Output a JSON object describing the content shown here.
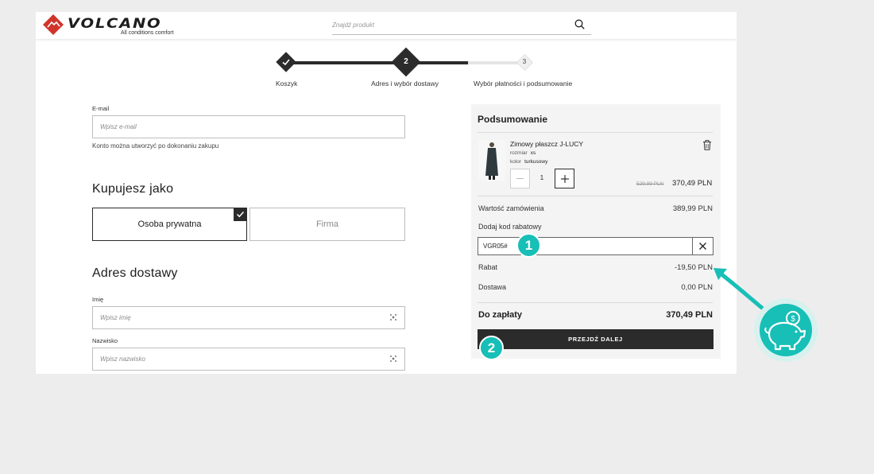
{
  "header": {
    "logo_text": "VOLCANO",
    "logo_tagline": "All conditions comfort",
    "search_placeholder": "Znajdź produkt"
  },
  "stepper": {
    "steps": [
      {
        "label": "Koszyk",
        "state": "done"
      },
      {
        "label": "Adres i wybór dostawy",
        "number": "2",
        "state": "active"
      },
      {
        "label": "Wybór płatności i podsumowanie",
        "number": "3",
        "state": "pending"
      }
    ]
  },
  "form": {
    "email_label": "E-mail",
    "email_placeholder": "Wpisz e-mail",
    "account_hint": "Konto można utworzyć po dokonaniu zakupu",
    "buy_as_title": "Kupujesz jako",
    "options": [
      {
        "label": "Osoba prywatna",
        "selected": true
      },
      {
        "label": "Firma",
        "selected": false
      }
    ],
    "delivery_title": "Adres dostawy",
    "first_name_label": "Imię",
    "first_name_placeholder": "Wpisz imię",
    "last_name_label": "Nazwisko",
    "last_name_placeholder": "Wpisz nazwisko"
  },
  "summary": {
    "title": "Podsumowanie",
    "product": {
      "name": "Zimowy płaszcz J-LUCY",
      "size_label": "rozmiar",
      "size_value": "xs",
      "color_label": "kolor",
      "color_value": "turkusowy",
      "quantity": "1",
      "old_price": "529,99 PLN",
      "price": "370,49 PLN"
    },
    "order_value_label": "Wartość zamówienia",
    "order_value": "389,99 PLN",
    "coupon_label": "Dodaj kod rabatowy",
    "coupon_code": "VGR05#",
    "discount_label": "Rabat",
    "discount_value": "-19,50 PLN",
    "shipping_label": "Dostawa",
    "shipping_value": "0,00 PLN",
    "total_label": "Do zapłaty",
    "total_value": "370,49 PLN",
    "next_button": "PRZEJDŹ DALEJ"
  },
  "annotations": {
    "marker_1": "1",
    "marker_2": "2",
    "accent_color": "#17bfb6"
  }
}
